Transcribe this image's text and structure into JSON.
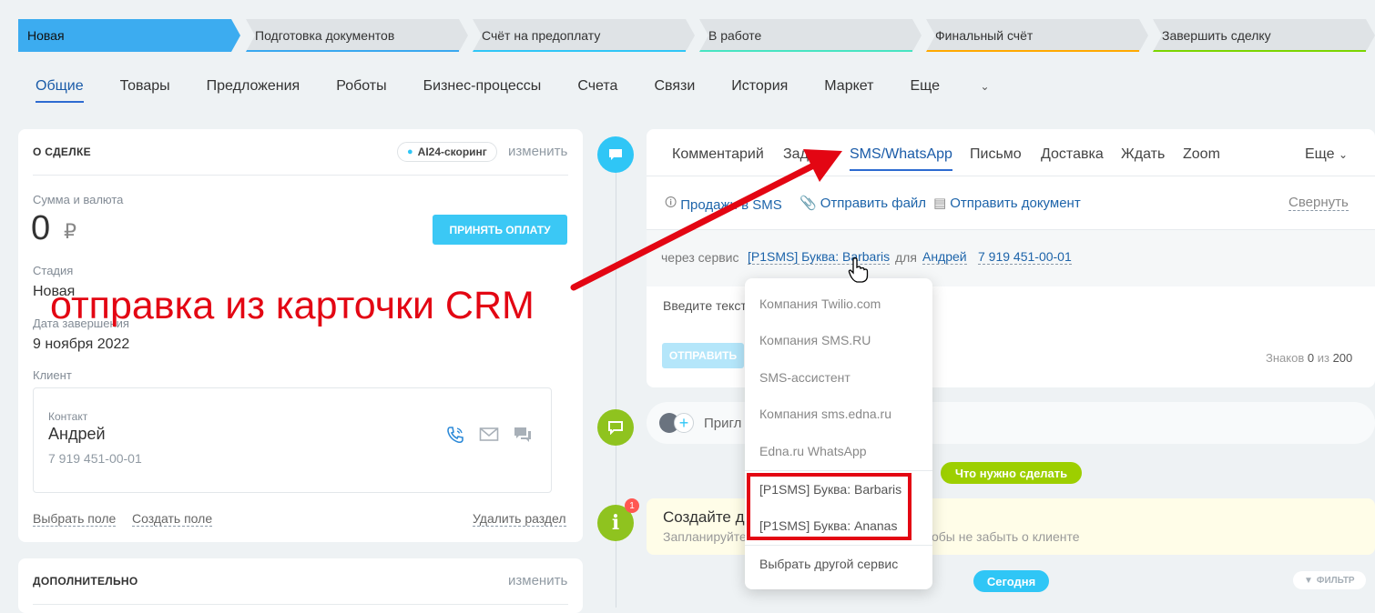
{
  "stages": [
    {
      "label": "Новая",
      "line": "#3cacf0"
    },
    {
      "label": "Подготовка документов",
      "line": "#39a8ef"
    },
    {
      "label": "Счёт на предоплату",
      "line": "#2fc6f6"
    },
    {
      "label": "В работе",
      "line": "#47e4c2"
    },
    {
      "label": "Финальный счёт",
      "line": "#ffa900"
    },
    {
      "label": "Завершить сделку",
      "line": "#7bd500"
    }
  ],
  "tabs": [
    "Общие",
    "Товары",
    "Предложения",
    "Роботы",
    "Бизнес-процессы",
    "Счета",
    "Связи",
    "История",
    "Маркет",
    "Еще"
  ],
  "deal": {
    "section_title": "О СДЕЛКЕ",
    "ai_badge": "AI24-скоринг",
    "edit": "изменить",
    "sum_label": "Сумма и валюта",
    "sum_value": "0",
    "currency": "₽",
    "accept_payment": "ПРИНЯТЬ ОПЛАТУ",
    "stage_label": "Стадия",
    "stage_value": "Новая",
    "close_label": "Дата завершения",
    "close_value": "9 ноября 2022",
    "client_label": "Клиент",
    "contact_label": "Контакт",
    "contact_name": "Андрей",
    "contact_phone": "7 919 451-00-01",
    "choose_field": "Выбрать поле",
    "create_field": "Создать поле",
    "delete_section": "Удалить раздел"
  },
  "extra": {
    "title": "ДОПОЛНИТЕЛЬНО",
    "edit": "изменить"
  },
  "annotation": "отправка из карточки CRM",
  "activity_tabs": [
    "Комментарий",
    "Задача",
    "SMS/WhatsApp",
    "Письмо",
    "Доставка",
    "Ждать",
    "Zoom",
    "Еще"
  ],
  "sms": {
    "sales_sms": "Продажи в SMS",
    "send_file": "Отправить файл",
    "send_document": "Отправить документ",
    "collapse": "Свернуть",
    "via_service": "через сервис",
    "service": "[P1SMS] Буква: Barbaris",
    "for": "для",
    "recipient": "Андрей",
    "phone": "7 919 451-00-01",
    "placeholder": "Введите текст",
    "send": "ОТПРАВИТЬ",
    "chars_label": "Знаков",
    "chars_count": "0",
    "chars_of": "из",
    "chars_max": "200"
  },
  "invite": "Пригл",
  "todo_pill": "Что нужно сделать",
  "create_case": {
    "title": "Создайте де",
    "subtitle": "Запланируйте",
    "subtitle_tail": "обы не забыть о клиенте",
    "badge": "1"
  },
  "today_pill": "Сегодня",
  "filter": "ФИЛЬТР",
  "dropdown": [
    "Компания Twilio.com",
    "Компания SMS.RU",
    "SMS-ассистент",
    "Компания sms.edna.ru",
    "Edna.ru WhatsApp",
    "[P1SMS] Буква: Barbaris",
    "[P1SMS] Буква: Ananas",
    "Выбрать другой сервис"
  ],
  "colors": {
    "accent": "#3bc8f5",
    "link": "#1d64aa",
    "red": "#e30613",
    "green": "#8fc31f",
    "todo": "#9dcf00"
  }
}
